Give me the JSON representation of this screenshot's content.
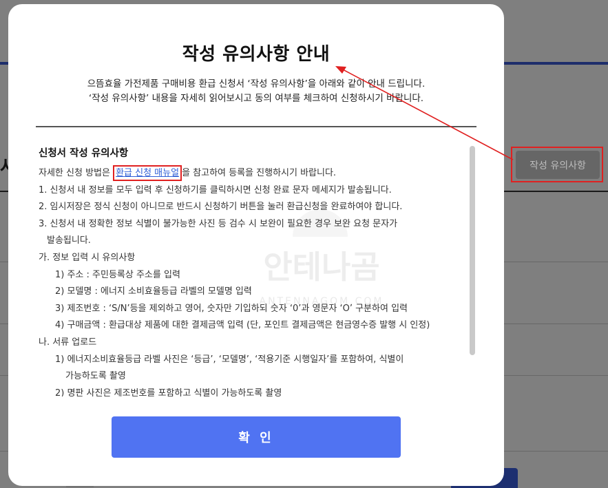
{
  "background": {
    "heading_fragment": "사"
  },
  "modal": {
    "title": "작성 유의사항 안내",
    "subtitle_line1": "으뜸효율 가전제품 구매비용 환급 신청서 ‘작성 유의사항’을 아래와 같이 안내 드립니다.",
    "subtitle_line2": "‘작성 유의사항’ 내용을 자세히 읽어보시고 동의 여부를 체크하여 신청하시기 바랍니다.",
    "content": {
      "heading": "신청서 작성 유의사항",
      "intro_before": "자세한 신청 방법은 ",
      "intro_link": "환급 신청 매뉴얼",
      "intro_after": "을 참고하여 등록을 진행하시기 바랍니다.",
      "item1": "1. 신청서 내 정보를 모두 입력 후 신청하기를 클릭하시면 신청 완료 문자 메세지가 발송됩니다.",
      "item2": "2. 임시저장은 정식 신청이 아니므로 반드시 신청하기 버튼을 눌러 환급신청을 완료하여야 합니다.",
      "item3": "3. 신청서 내 정확한 정보 식별이 불가능한 사진 등 검수 시 보완이 필요한 경우 보완 요청 문자가",
      "item3_cont": "발송됩니다.",
      "section_ga": "가. 정보 입력 시 유의사항",
      "ga1": "1) 주소 : 주민등록상 주소를 입력",
      "ga2": "2) 모델명 : 에너지 소비효율등급 라벨의 모델명 입력",
      "ga3": "3) 제조번호 : ‘S/N’등을 제외하고 영어, 숫자만 기입하되 숫자 ‘0’과 영문자 ‘O’ 구분하여 입력",
      "ga4": "4) 구매금액 : 환급대상 제품에 대한 결제금액 입력 (단, 포인트 결제금액은 현금영수증 발행 시 인정)",
      "section_na": "나. 서류 업로드",
      "na1": "1) 에너지소비효율등급 라벨 사진은 ‘등급’, ‘모델명’, ‘적용기준 시행일자’를 포함하여, 식별이",
      "na1_cont": "가능하도록 촬영",
      "na2": "2) 명판 사진은 제조번호를 포함하고 식별이 가능하도록 촬영"
    },
    "confirm_label": "확 인"
  },
  "side_button_label": "작성 유의사항",
  "watermark": {
    "text": "안테나곰",
    "sub": "ANTENNAGOM.COM"
  },
  "colors": {
    "accent_blue": "#5073f2",
    "annotation_red": "#e02020",
    "link_blue": "#2f5fd6"
  }
}
